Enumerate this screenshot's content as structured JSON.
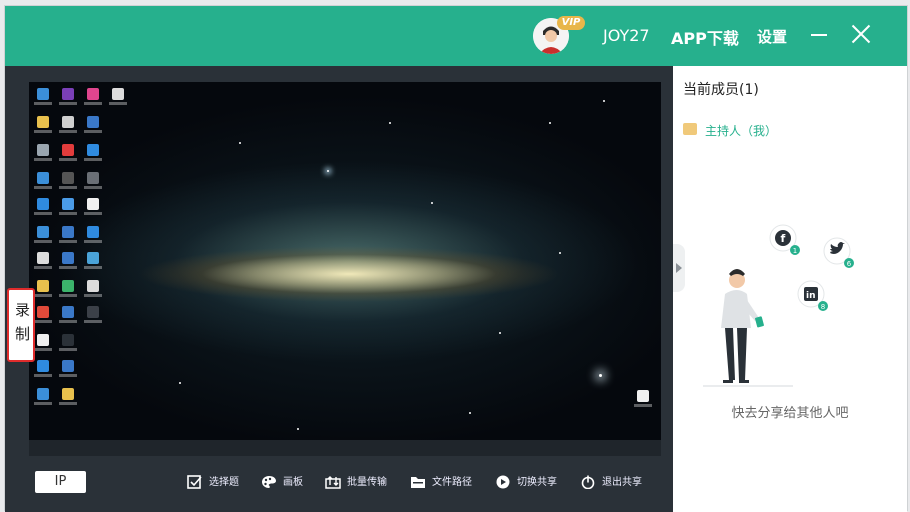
{
  "titlebar": {
    "vip_badge": "VIP",
    "username": "JOY27",
    "app_download": "APP下载",
    "settings": "设置"
  },
  "screen_share": {
    "record_label_1": "录",
    "record_label_2": "制"
  },
  "toolbar": {
    "ip_label": "IP",
    "tools": [
      {
        "label": "选择题",
        "icon": "quiz-icon"
      },
      {
        "label": "画板",
        "icon": "palette-icon"
      },
      {
        "label": "批量传输",
        "icon": "batch-transfer-icon"
      },
      {
        "label": "文件路径",
        "icon": "folder-icon"
      },
      {
        "label": "切换共享",
        "icon": "switch-share-icon"
      },
      {
        "label": "退出共享",
        "icon": "exit-share-icon"
      }
    ]
  },
  "members": {
    "title": "当前成员(1)",
    "host_label": "主持人（我）"
  },
  "share_prompt": {
    "text": "快去分享给其他人吧",
    "facebook_count": "1",
    "twitter_count": "6",
    "linkedin_count": "8"
  },
  "colors": {
    "brand": "#26b08d",
    "toolbar_bg": "#2a3138",
    "record_border": "#e02c2c"
  }
}
